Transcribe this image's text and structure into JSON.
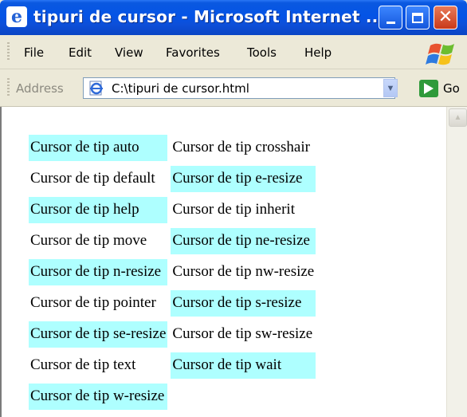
{
  "window": {
    "title": "tipuri de cursor - Microsoft Internet ...",
    "app_icon_glyph": "e",
    "close_glyph": "✕"
  },
  "menu": [
    "File",
    "Edit",
    "View",
    "Favorites",
    "Tools",
    "Help"
  ],
  "address_bar": {
    "label": "Address",
    "value": "C:\\tipuri de cursor.html",
    "go_label": "Go"
  },
  "colors": {
    "highlight": "#aeffff",
    "titlebar": "#0454e6"
  },
  "table": {
    "rows": [
      [
        {
          "text": "Cursor de tip auto",
          "highlight": true
        },
        {
          "text": "Cursor de tip crosshair",
          "highlight": false
        }
      ],
      [
        {
          "text": "Cursor de tip default",
          "highlight": false
        },
        {
          "text": "Cursor de tip e-resize",
          "highlight": true
        }
      ],
      [
        {
          "text": "Cursor de tip help",
          "highlight": true
        },
        {
          "text": "Cursor de tip inherit",
          "highlight": false
        }
      ],
      [
        {
          "text": "Cursor de tip move",
          "highlight": false
        },
        {
          "text": "Cursor de tip ne-resize",
          "highlight": true
        }
      ],
      [
        {
          "text": "Cursor de tip n-resize",
          "highlight": true
        },
        {
          "text": "Cursor de tip nw-resize",
          "highlight": false
        }
      ],
      [
        {
          "text": "Cursor de tip pointer",
          "highlight": false
        },
        {
          "text": "Cursor de tip s-resize",
          "highlight": true
        }
      ],
      [
        {
          "text": "Cursor de tip se-resize",
          "highlight": true
        },
        {
          "text": "Cursor de tip sw-resize",
          "highlight": false
        }
      ],
      [
        {
          "text": "Cursor de tip text",
          "highlight": false
        },
        {
          "text": "Cursor de tip wait",
          "highlight": true
        }
      ],
      [
        {
          "text": "Cursor de tip w-resize",
          "highlight": true
        }
      ]
    ]
  }
}
